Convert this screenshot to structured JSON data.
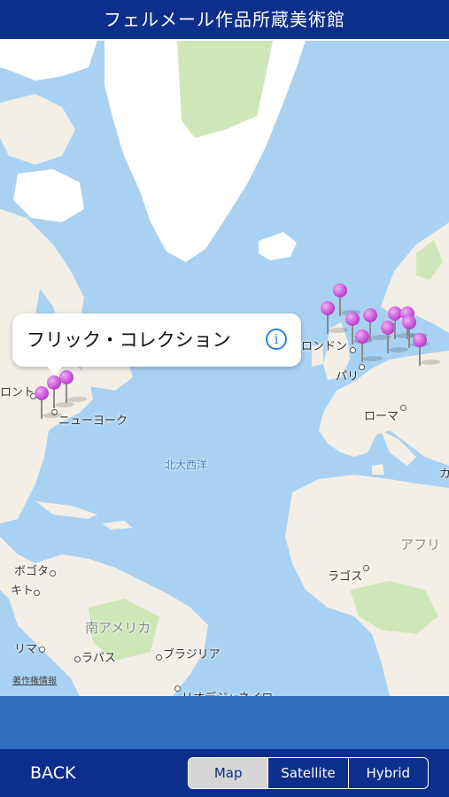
{
  "header": {
    "title": "フェルメール作品所蔵美術館"
  },
  "map": {
    "places": {
      "toronto": "ロント",
      "new_york": "ニューヨーク",
      "london": "ロンドン",
      "paris": "パリ",
      "rome": "ローマ",
      "atlantic": "北大西洋",
      "bogota": "ボゴタ",
      "quito": "キト",
      "lima": "リマ",
      "la_paz": "ラパス",
      "brasilia": "ブラジリア",
      "rio": "リオデジャネイロ",
      "south_america": "南アメリカ",
      "lagos": "ラゴス",
      "africa": "アフリ",
      "cairo_edge": "カ"
    },
    "legal": "著作権情報",
    "pin_color": "#c24cd6"
  },
  "callout": {
    "title": "フリック・コレクション",
    "info_glyph": "i"
  },
  "footer": {
    "back_label": "BACK",
    "map_types": [
      "Map",
      "Satellite",
      "Hybrid"
    ],
    "selected": "Map"
  },
  "colors": {
    "header": "#0d2f8c",
    "band": "#2f6fbd",
    "ocean": "#a9d2f2",
    "land": "#f4efe6",
    "ice": "#ffffff",
    "forest": "#cfe7b8"
  }
}
